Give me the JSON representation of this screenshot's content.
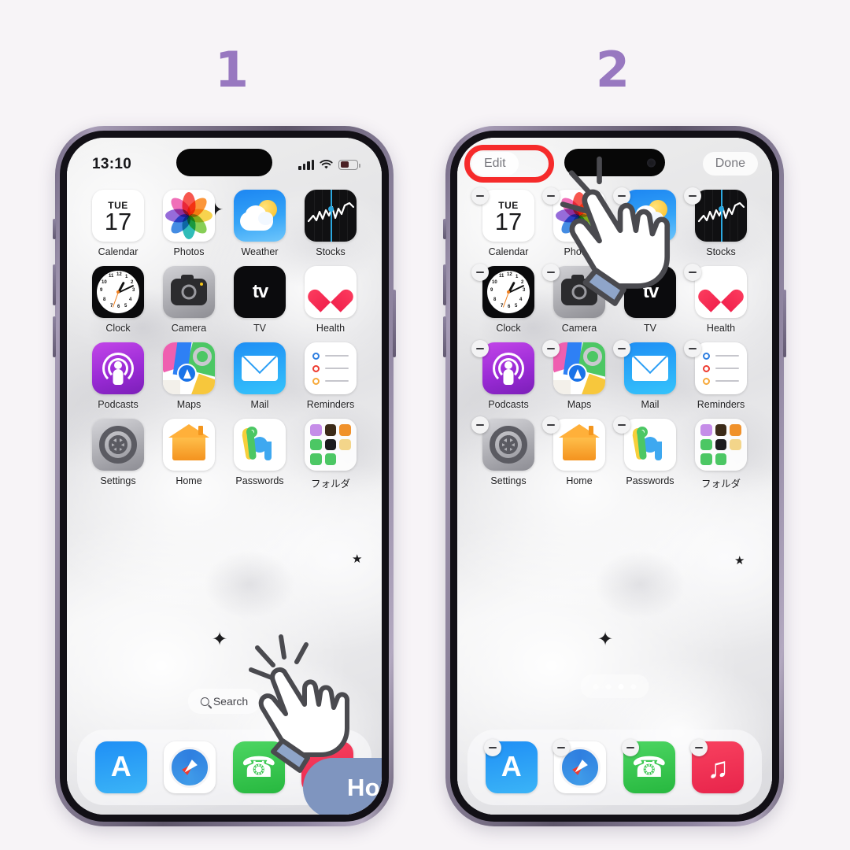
{
  "steps": [
    {
      "number": "1"
    },
    {
      "number": "2"
    }
  ],
  "colors": {
    "page_background": "#F7F4F7",
    "step_number": "#9878C0",
    "highlight_ring": "#F62B2B",
    "hold_pill": "#7F95BF",
    "frame": "#6B6278"
  },
  "phone1": {
    "status_bar": {
      "time": "13:10",
      "signal_icon": "cellular-bars-icon",
      "wifi_icon": "wifi-icon",
      "battery_icon": "battery-icon",
      "battery_level_percent": 52
    },
    "apps": [
      {
        "name": "Calendar",
        "icon": "calendar-icon",
        "day_of_week": "TUE",
        "day": "17"
      },
      {
        "name": "Photos",
        "icon": "photos-icon"
      },
      {
        "name": "Weather",
        "icon": "weather-icon"
      },
      {
        "name": "Stocks",
        "icon": "stocks-icon"
      },
      {
        "name": "Clock",
        "icon": "clock-icon"
      },
      {
        "name": "Camera",
        "icon": "camera-icon"
      },
      {
        "name": "TV",
        "icon": "apple-tv-icon"
      },
      {
        "name": "Health",
        "icon": "health-icon"
      },
      {
        "name": "Podcasts",
        "icon": "podcasts-icon"
      },
      {
        "name": "Maps",
        "icon": "maps-icon"
      },
      {
        "name": "Mail",
        "icon": "mail-icon"
      },
      {
        "name": "Reminders",
        "icon": "reminders-icon"
      },
      {
        "name": "Settings",
        "icon": "settings-icon"
      },
      {
        "name": "Home",
        "icon": "home-icon"
      },
      {
        "name": "Passwords",
        "icon": "passwords-icon"
      },
      {
        "name": "フォルダ",
        "icon": "folder-icon"
      }
    ],
    "search": {
      "label": "Search",
      "icon": "search-icon"
    },
    "dock": [
      {
        "name": "App Store",
        "icon": "app-store-icon"
      },
      {
        "name": "Safari",
        "icon": "safari-icon"
      },
      {
        "name": "Phone",
        "icon": "phone-icon"
      },
      {
        "name": "Music",
        "icon": "music-icon"
      }
    ],
    "gesture": {
      "label": "Hold",
      "cursor": "hand-pointer-icon"
    }
  },
  "phone2": {
    "edit_button": "Edit",
    "done_button": "Done",
    "edit_mode": true,
    "remove_badge_icon": "minus-badge-icon",
    "page_dots": {
      "count": 4,
      "active_index": 2
    },
    "apps": [
      {
        "name": "Calendar",
        "icon": "calendar-icon",
        "day_of_week": "TUE",
        "day": "17",
        "removable": true
      },
      {
        "name": "Photos",
        "icon": "photos-icon",
        "removable": true
      },
      {
        "name": "Weather",
        "icon": "weather-icon",
        "removable": true
      },
      {
        "name": "Stocks",
        "icon": "stocks-icon",
        "removable": true
      },
      {
        "name": "Clock",
        "icon": "clock-icon",
        "removable": true
      },
      {
        "name": "Camera",
        "icon": "camera-icon",
        "removable": true
      },
      {
        "name": "TV",
        "icon": "apple-tv-icon",
        "removable": true
      },
      {
        "name": "Health",
        "icon": "health-icon",
        "removable": true
      },
      {
        "name": "Podcasts",
        "icon": "podcasts-icon",
        "removable": true
      },
      {
        "name": "Maps",
        "icon": "maps-icon",
        "removable": true
      },
      {
        "name": "Mail",
        "icon": "mail-icon",
        "removable": true
      },
      {
        "name": "Reminders",
        "icon": "reminders-icon",
        "removable": true
      },
      {
        "name": "Settings",
        "icon": "settings-icon",
        "removable": true
      },
      {
        "name": "Home",
        "icon": "home-icon",
        "removable": true
      },
      {
        "name": "Passwords",
        "icon": "passwords-icon",
        "removable": true
      },
      {
        "name": "フォルダ",
        "icon": "folder-icon",
        "removable": false
      }
    ],
    "dock": [
      {
        "name": "App Store",
        "icon": "app-store-icon",
        "removable": true
      },
      {
        "name": "Safari",
        "icon": "safari-icon",
        "removable": true
      },
      {
        "name": "Phone",
        "icon": "phone-icon",
        "removable": true
      },
      {
        "name": "Music",
        "icon": "music-icon",
        "removable": true
      }
    ],
    "gesture": {
      "cursor": "hand-pointer-icon",
      "target": "Edit"
    }
  }
}
